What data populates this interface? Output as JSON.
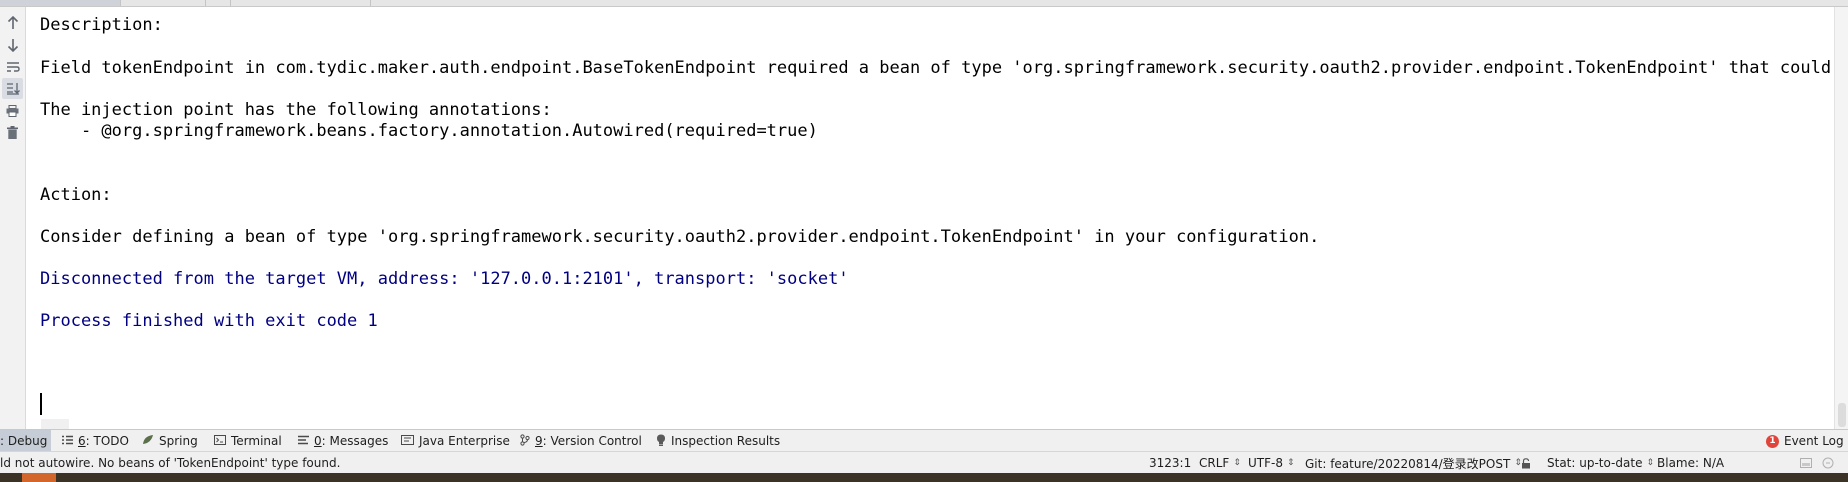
{
  "console": {
    "lines": [
      "Description:",
      "",
      "Field tokenEndpoint in com.tydic.maker.auth.endpoint.BaseTokenEndpoint required a bean of type 'org.springframework.security.oauth2.provider.endpoint.TokenEndpoint' that could not be",
      "",
      "The injection point has the following annotations:",
      "    - @org.springframework.beans.factory.annotation.Autowired(required=true)",
      "",
      "",
      "Action:",
      "",
      "Consider defining a bean of type 'org.springframework.security.oauth2.provider.endpoint.TokenEndpoint' in your configuration.",
      "",
      "Disconnected from the target VM, address: '127.0.0.1:2101', transport: 'socket'",
      "",
      "Process finished with exit code 1"
    ]
  },
  "left_toolbar": {
    "icons": [
      "up-arrow-icon",
      "down-arrow-icon",
      "soft-wrap-icon",
      "scroll-to-end-icon",
      "print-icon",
      "trash-icon"
    ]
  },
  "tool_window_bar": {
    "tabs": [
      {
        "num": "",
        "label": ": Debug",
        "icon": "debug-icon"
      },
      {
        "num": "6",
        "label": ": TODO",
        "icon": "todo-icon"
      },
      {
        "num": "",
        "label": "Spring",
        "icon": "spring-icon"
      },
      {
        "num": "",
        "label": "Terminal",
        "icon": "terminal-icon"
      },
      {
        "num": "0",
        "label": ": Messages",
        "icon": "messages-icon"
      },
      {
        "num": "",
        "label": "Java Enterprise",
        "icon": "java-enterprise-icon"
      },
      {
        "num": "9",
        "label": ": Version Control",
        "icon": "version-control-icon"
      },
      {
        "num": "",
        "label": "Inspection Results",
        "icon": "inspection-icon"
      }
    ],
    "event_log": {
      "badge": "1",
      "label": "Event Log"
    }
  },
  "status_bar": {
    "message": "ld not autowire. No beans of 'TokenEndpoint' type found.",
    "position": "3123:1",
    "line_separator": "CRLF",
    "encoding": "UTF-8",
    "git_branch": "Git: feature/20220814/登录改POST",
    "stat": "Stat: up-to-date",
    "blame": "Blame: N/A"
  },
  "colors": {
    "text": "#000000",
    "system_output": "#000080",
    "event_badge": "#e0443a",
    "accent": "#d3672b"
  }
}
